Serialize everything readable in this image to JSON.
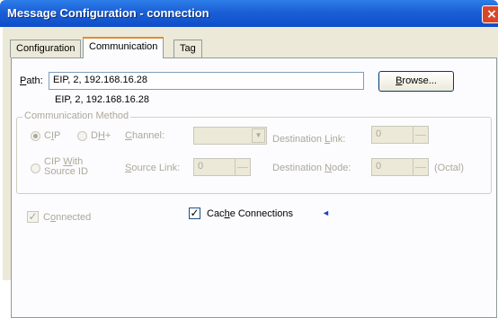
{
  "window": {
    "title": "Message Configuration - connection",
    "close_glyph": "×"
  },
  "tabs": [
    {
      "label": "Configuration"
    },
    {
      "label": "Communication",
      "active": true
    },
    {
      "label": "Tag"
    }
  ],
  "path": {
    "label_accel": "P",
    "label_rest": "ath:",
    "value": "EIP, 2, 192.168.16.28",
    "resolved": "EIP, 2, 192.168.16.28",
    "browse_accel": "B",
    "browse_rest": "rowse..."
  },
  "method": {
    "legend": "Communication Method",
    "cip": {
      "accel": "I",
      "pre": "C",
      "post": "P",
      "selected": true
    },
    "dhplus": {
      "pre": "D",
      "accel": "H",
      "post": "+",
      "selected": false
    },
    "cip_source": {
      "line1_pre": "CIP ",
      "line1_accel": "W",
      "line1_post": "ith",
      "line2": "Source ID",
      "selected": false
    },
    "channel": {
      "accel": "C",
      "rest": "hannel:",
      "value": ""
    },
    "dest_link": {
      "pre": "Destination ",
      "accel": "L",
      "post": "ink:",
      "value": "0"
    },
    "source_link": {
      "accel": "S",
      "rest": "ource Link:",
      "value": "0"
    },
    "dest_node": {
      "pre": "Destination ",
      "accel": "N",
      "post": "ode:",
      "value": "0",
      "suffix": "(Octal)"
    }
  },
  "connected": {
    "accel": "o",
    "pre": "C",
    "post": "nnected",
    "checked": true
  },
  "cache": {
    "pre": "Cac",
    "accel": "h",
    "post": "e Connections",
    "checked": true,
    "arrow_glyph": "◄"
  },
  "colors": {
    "titlebar": "#0d4ec8",
    "dialog": "#ece9d8",
    "panel": "#fcfcfe",
    "disabled_text": "#aca899",
    "arrow": "#1b3fd8"
  }
}
